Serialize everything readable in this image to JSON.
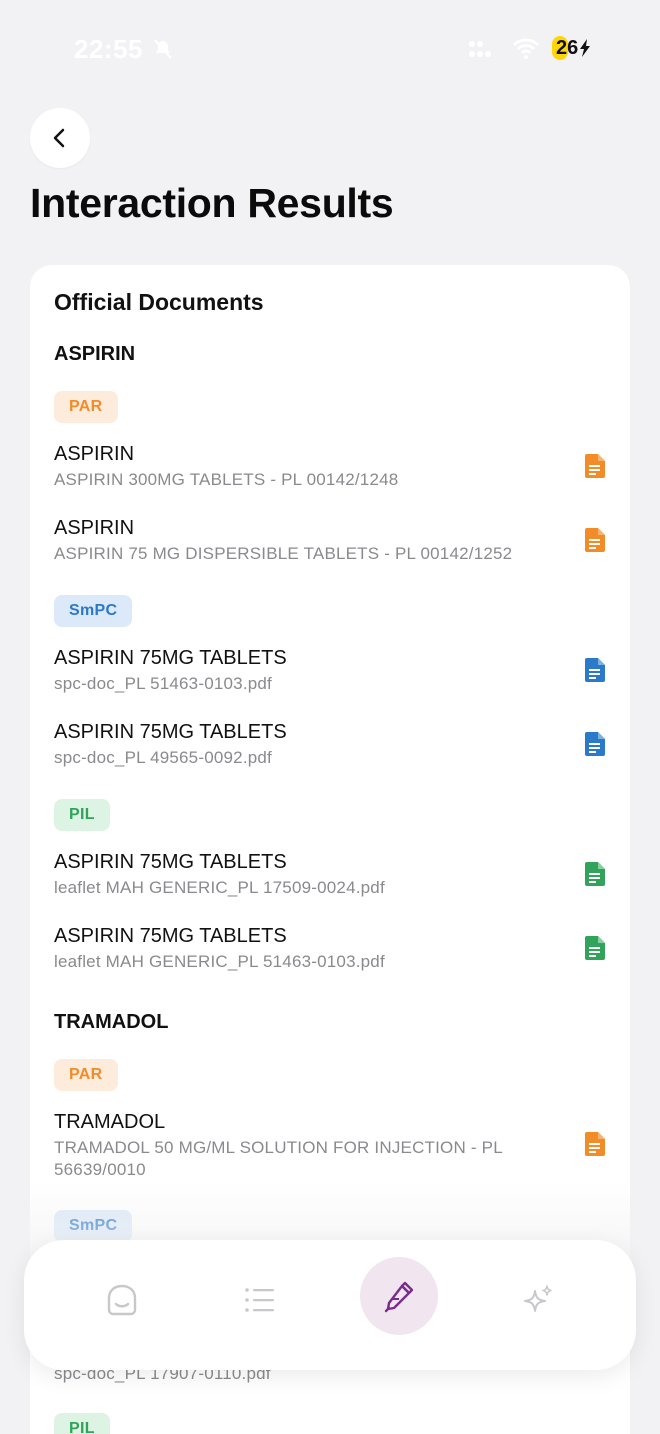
{
  "status_bar": {
    "time": "22:55",
    "battery": "26"
  },
  "header": {
    "back_icon": "chevron-left-icon",
    "title": "Interaction Results"
  },
  "documents": {
    "title": "Official Documents",
    "drugs": [
      {
        "name": "ASPIRIN",
        "groups": [
          {
            "type": "PAR",
            "items": [
              {
                "name": "ASPIRIN",
                "subtitle": "ASPIRIN 300MG TABLETS - PL 00142/1248"
              },
              {
                "name": "ASPIRIN",
                "subtitle": "ASPIRIN 75 MG DISPERSIBLE TABLETS - PL 00142/1252"
              }
            ]
          },
          {
            "type": "SmPC",
            "items": [
              {
                "name": "ASPIRIN 75MG TABLETS",
                "subtitle": "spc-doc_PL 51463-0103.pdf"
              },
              {
                "name": "ASPIRIN 75MG TABLETS",
                "subtitle": "spc-doc_PL 49565-0092.pdf"
              }
            ]
          },
          {
            "type": "PIL",
            "items": [
              {
                "name": "ASPIRIN 75MG TABLETS",
                "subtitle": "leaflet MAH GENERIC_PL 17509-0024.pdf"
              },
              {
                "name": "ASPIRIN 75MG TABLETS",
                "subtitle": "leaflet MAH GENERIC_PL 51463-0103.pdf"
              }
            ]
          }
        ]
      },
      {
        "name": "TRAMADOL",
        "groups": [
          {
            "type": "PAR",
            "items": [
              {
                "name": "TRAMADOL",
                "subtitle": "TRAMADOL 50 MG/ML SOLUTION FOR INJECTION - PL 56639/0010"
              }
            ]
          },
          {
            "type": "SmPC",
            "items": [
              {
                "name": "",
                "subtitle": "spc-doc_PL 17907-0110.pdf"
              }
            ]
          },
          {
            "type": "PIL",
            "items": []
          }
        ]
      }
    ]
  },
  "colors": {
    "par": "#f28c28",
    "smpc": "#2b79c9",
    "pil": "#31a35a",
    "accent": "#7a2c8c"
  },
  "bottom_nav": {
    "items": [
      {
        "icon": "chat-bubble-icon",
        "active": false
      },
      {
        "icon": "list-icon",
        "active": false
      },
      {
        "icon": "pipette-icon",
        "active": true
      },
      {
        "icon": "sparkles-icon",
        "active": false
      }
    ]
  }
}
